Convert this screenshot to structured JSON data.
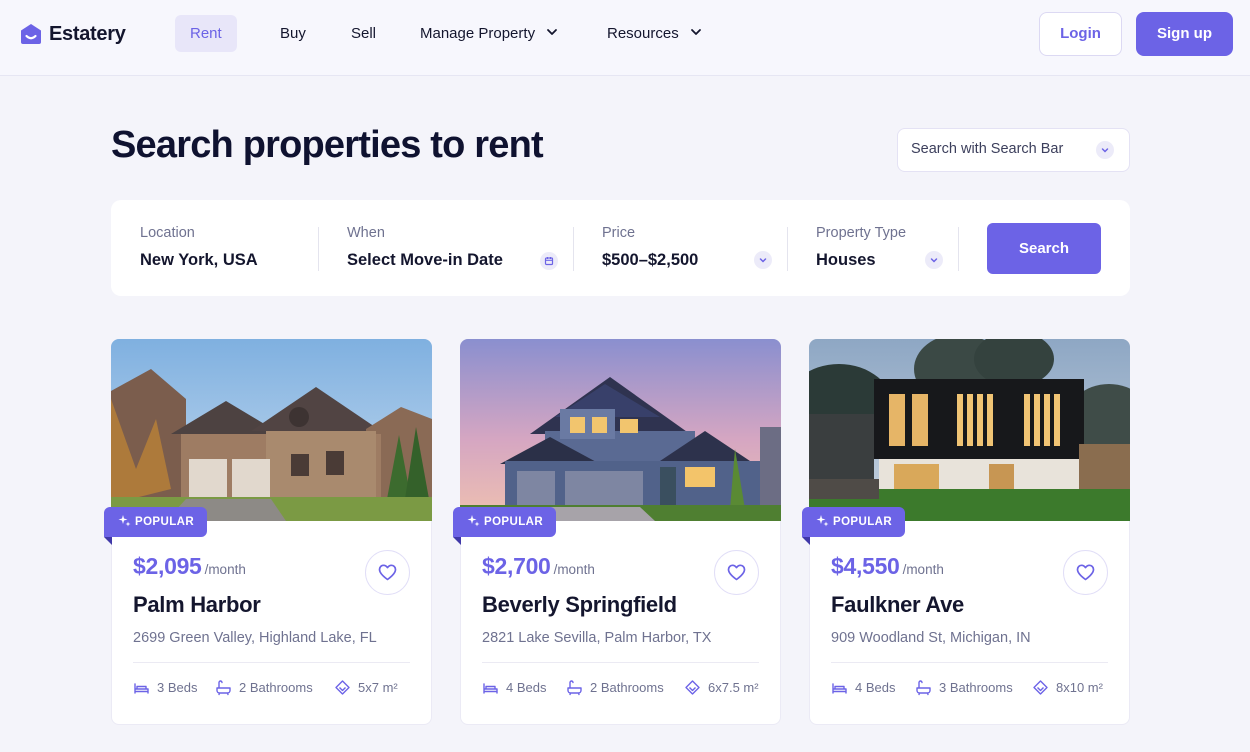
{
  "brand": {
    "name": "Estatery",
    "accent": "#6c63e6"
  },
  "nav": {
    "items": [
      {
        "label": "Rent"
      },
      {
        "label": "Buy"
      },
      {
        "label": "Sell"
      },
      {
        "label": "Manage Property"
      },
      {
        "label": "Resources"
      }
    ],
    "login": "Login",
    "signup": "Sign up"
  },
  "hero": {
    "title": "Search properties to rent",
    "search_mode": "Search with Search Bar"
  },
  "search": {
    "location": {
      "label": "Location",
      "value": "New York, USA"
    },
    "when": {
      "label": "When",
      "value": "Select Move-in Date"
    },
    "price": {
      "label": "Price",
      "value": "$500–$2,500"
    },
    "type": {
      "label": "Property Type",
      "value": "Houses"
    },
    "button": "Search"
  },
  "listings": [
    {
      "badge": "POPULAR",
      "price": "$2,095",
      "unit": "/month",
      "name": "Palm Harbor",
      "address": "2699 Green Valley, Highland Lake, FL",
      "beds": "3 Beds",
      "baths": "2 Bathrooms",
      "area": "5x7 m²"
    },
    {
      "badge": "POPULAR",
      "price": "$2,700",
      "unit": "/month",
      "name": "Beverly Springfield",
      "address": "2821 Lake Sevilla, Palm Harbor, TX",
      "beds": "4 Beds",
      "baths": "2 Bathrooms",
      "area": "6x7.5 m²"
    },
    {
      "badge": "POPULAR",
      "price": "$4,550",
      "unit": "/month",
      "name": "Faulkner Ave",
      "address": "909 Woodland St, Michigan, IN",
      "beds": "4 Beds",
      "baths": "3 Bathrooms",
      "area": "8x10 m²"
    }
  ]
}
